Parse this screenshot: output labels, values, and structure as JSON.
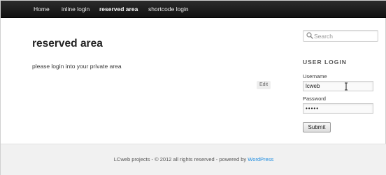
{
  "nav": {
    "items": [
      {
        "label": "Home"
      },
      {
        "label": "inline login"
      },
      {
        "label": "reserved area"
      },
      {
        "label": "shortcode login"
      }
    ],
    "active_index": 2
  },
  "main": {
    "title": "reserved area",
    "body_text": "please login into your private area",
    "edit_label": "Edit"
  },
  "sidebar": {
    "search": {
      "placeholder": "Search",
      "icon": "search-icon"
    },
    "login_widget": {
      "title": "USER LOGIN",
      "username_label": "Username",
      "username_value": "lcweb",
      "password_label": "Password",
      "password_value": "•••••",
      "submit_label": "Submit"
    }
  },
  "footer": {
    "text": "LCweb projects - © 2012 all rights reserved - powered by",
    "link": "WordPress"
  },
  "colors": {
    "nav_bg": "#1a1a1a",
    "link": "#1b8be0",
    "footer_bg": "#f1f1f1"
  }
}
